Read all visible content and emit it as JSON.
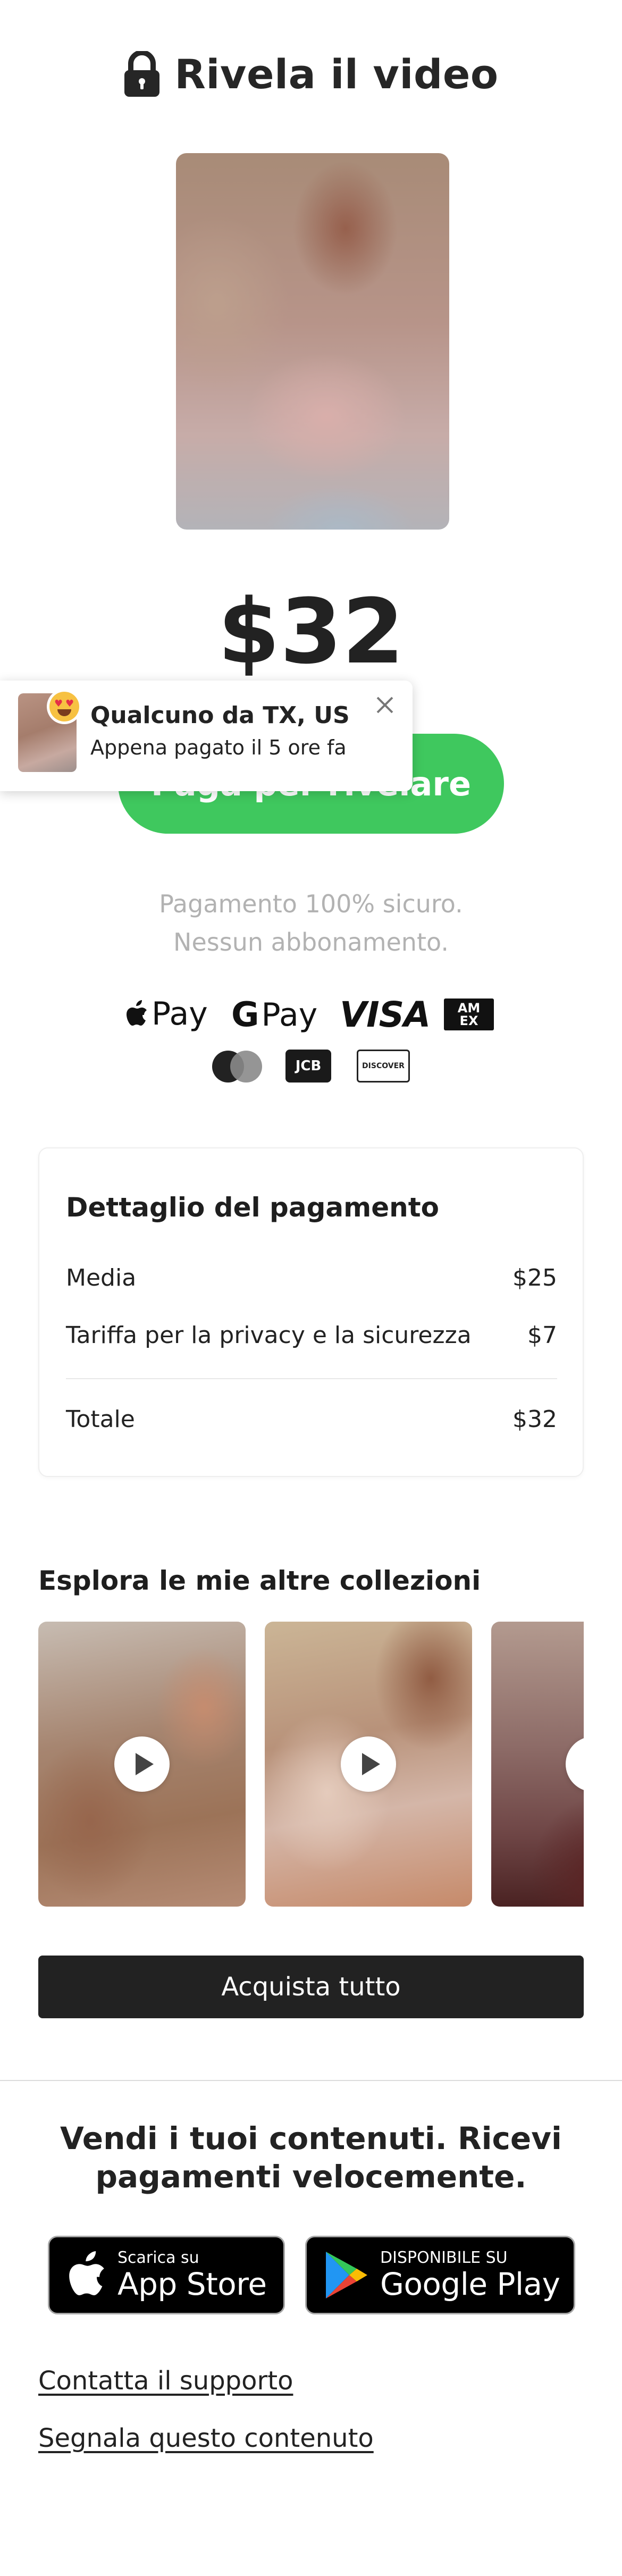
{
  "header": {
    "title": "Rivela il video",
    "icon": "lock-icon"
  },
  "video": {
    "icon": "play-icon"
  },
  "price": "$32",
  "toast": {
    "title": "Qualcuno da TX, US",
    "subtitle": "Appena pagato il 5 ore fa",
    "emoji": "😍"
  },
  "pay_button": {
    "label": "Paga per rivelare"
  },
  "secure": {
    "line1": "Pagamento 100% sicuro.",
    "line2": "Nessun abbonamento."
  },
  "payment_methods": {
    "apple_pay": "Pay",
    "google_pay_g": "G",
    "google_pay": "Pay",
    "visa": "VISA",
    "amex_1": "AM",
    "amex_2": "EX",
    "jcb": "JCB",
    "discover": "DISCOVER"
  },
  "details": {
    "title": "Dettaglio del pagamento",
    "rows": [
      {
        "label": "Media",
        "value": "$25"
      },
      {
        "label": "Tariffa per la privacy e la sicurezza",
        "value": "$7"
      }
    ],
    "total": {
      "label": "Totale",
      "value": "$32"
    }
  },
  "collections": {
    "title": "Esplora le mie altre collezioni"
  },
  "buy_all": "Acquista tutto",
  "promo": {
    "line1": "Vendi i tuoi contenuti. Ricevi",
    "line2": "pagamenti velocemente."
  },
  "stores": {
    "apple": {
      "small": "Scarica su",
      "big": "App Store"
    },
    "google": {
      "small": "DISPONIBILE SU",
      "big": "Google Play"
    }
  },
  "links": {
    "support": "Contatta il supporto",
    "report": "Segnala questo contenuto"
  },
  "colors": {
    "accent_green": "#3fc85e",
    "dark": "#222222",
    "muted": "#b2b2b2"
  }
}
